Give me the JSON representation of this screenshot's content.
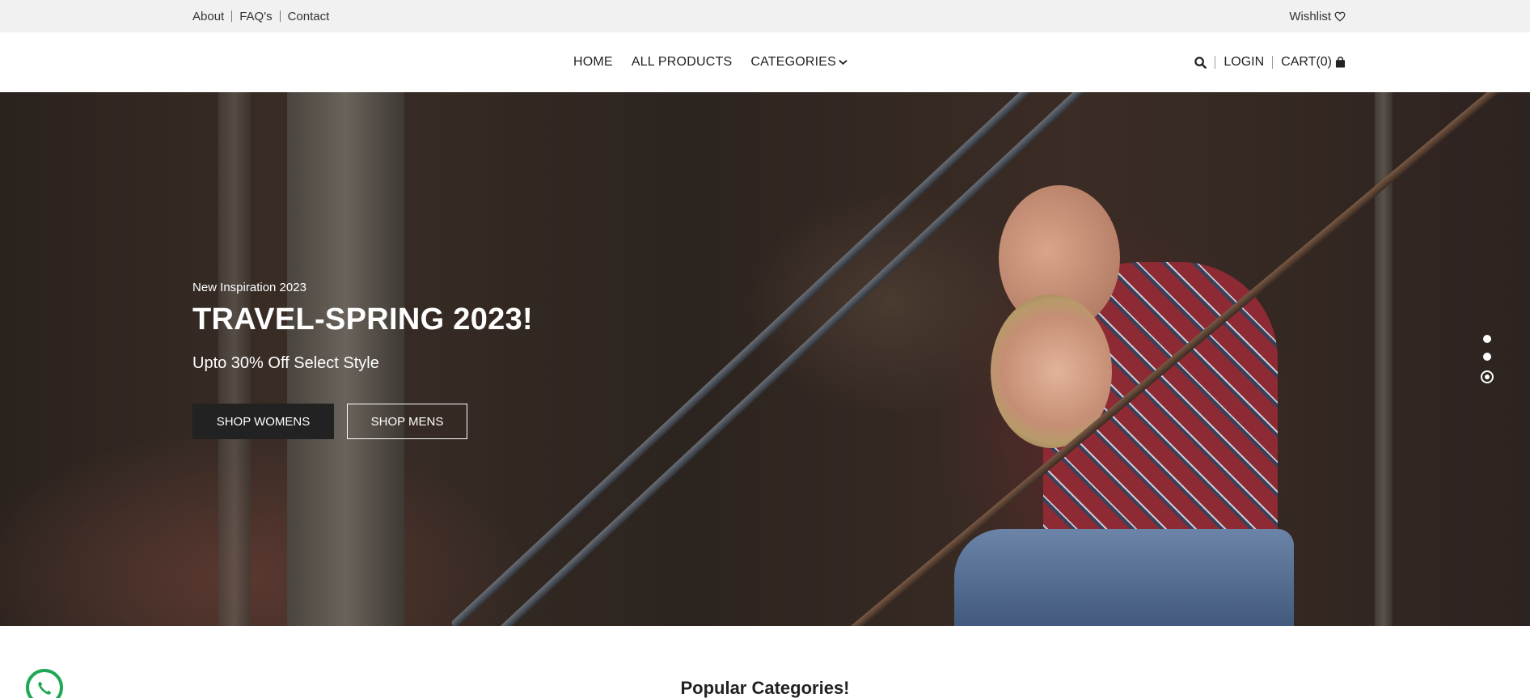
{
  "topbar": {
    "links": [
      "About",
      "FAQ's",
      "Contact"
    ],
    "wishlist_label": "Wishlist",
    "wishlist_icon": "heart-icon"
  },
  "header": {
    "nav": [
      "HOME",
      "ALL PRODUCTS",
      "CATEGORIES"
    ],
    "categories_icon": "chevron-down-icon",
    "search_icon": "search-icon",
    "login_label": "LOGIN",
    "cart_label": "CART(0)",
    "cart_icon": "shopping-bag-icon"
  },
  "hero": {
    "eyebrow": "New Inspiration 2023",
    "headline": "TRAVEL-SPRING 2023!",
    "subheading": "Upto 30% Off Select Style",
    "buttons": [
      "SHOP WOMENS",
      "SHOP MENS"
    ],
    "slides_count": 3,
    "active_slide": 3
  },
  "section": {
    "title": "Popular Categories!"
  },
  "floating": {
    "whatsapp_icon": "whatsapp-icon"
  },
  "colors": {
    "topbar_bg": "#f1f1f1",
    "dark_button": "#222222",
    "whatsapp_green": "#1fa855"
  }
}
